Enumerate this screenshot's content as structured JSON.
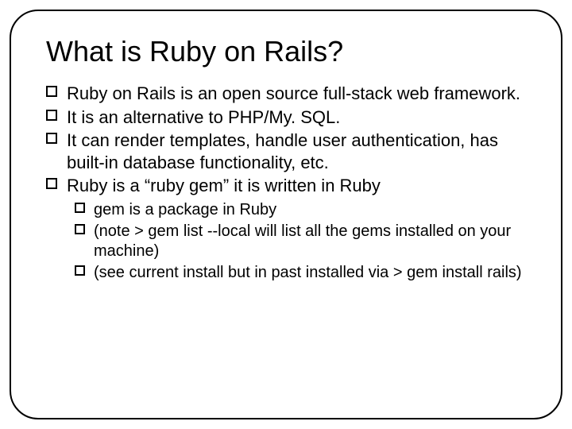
{
  "title": "What is Ruby on Rails?",
  "bullets": [
    {
      "text": "Ruby on Rails is an open source full-stack web framework."
    },
    {
      "text": "It is an alternative to PHP/My. SQL."
    },
    {
      "text": "It can render templates, handle user authentication, has built-in database functionality, etc."
    },
    {
      "text": "Ruby is a “ruby gem”  it is written in Ruby",
      "children": [
        {
          "text": "gem is a package in Ruby"
        },
        {
          "text": " (note   > gem list --local      will list all the gems installed on your machine)"
        },
        {
          "text": "  (see current install but in past installed via  > gem install rails)"
        }
      ]
    }
  ]
}
